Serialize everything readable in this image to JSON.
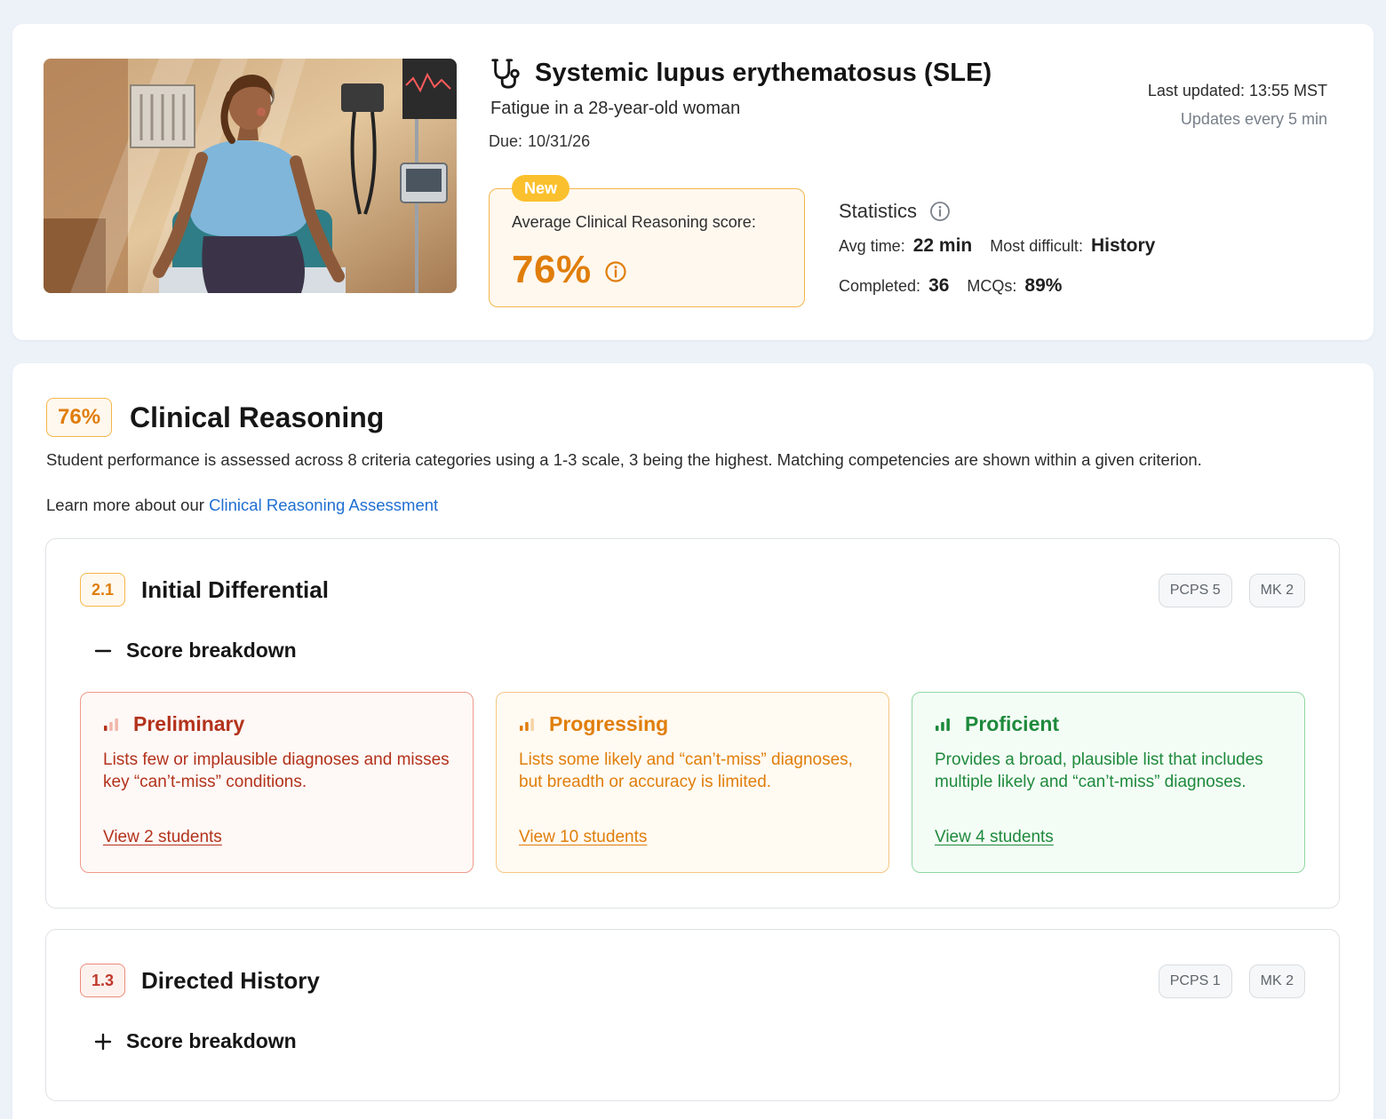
{
  "colors": {
    "page_bg": "#edf2f9",
    "accent_orange": "#e07e0b",
    "badge_yellow": "#fbc02d",
    "link_blue": "#1f6fd1",
    "preliminary_red": "#b3321b",
    "proficient_green": "#1e8a3c"
  },
  "case": {
    "title": "Systemic lupus erythematosus (SLE)",
    "title_icon": "stethoscope-icon",
    "subtitle": "Fatigue in a 28-year-old woman",
    "due_label": "Due:",
    "due_value": "10/31/26",
    "last_updated": "Last updated: 13:55 MST",
    "update_frequency": "Updates every 5 min",
    "image_alt": "Illustration of a tired young woman seated on an exam table in a clinic"
  },
  "score_box": {
    "badge": "New",
    "label": "Average Clinical Reasoning score:",
    "value": "76%"
  },
  "statistics": {
    "title": "Statistics",
    "avg_time_label": "Avg time:",
    "avg_time_value": "22 min",
    "most_difficult_label": "Most difficult:",
    "most_difficult_value": "History",
    "completed_label": "Completed:",
    "completed_value": "36",
    "mcqs_label": "MCQs:",
    "mcqs_value": "89%"
  },
  "clinical_reasoning": {
    "score": "76%",
    "title": "Clinical Reasoning",
    "description": "Student performance is assessed across 8 criteria categories using a 1-3 scale, 3 being the highest. Matching competencies are shown within a given criterion.",
    "learn_more_prefix": "Learn more about our",
    "learn_more_link": "Clinical Reasoning Assessment"
  },
  "criteria": [
    {
      "number": "2.1",
      "title": "Initial Differential",
      "tags": [
        "PCPS 5",
        "MK 2"
      ],
      "breakdown_label": "Score breakdown",
      "expanded": true,
      "levels": [
        {
          "title": "Preliminary",
          "description": "Lists few or implausible diagnoses and misses key “can’t-miss” conditions.",
          "link": "View 2 students"
        },
        {
          "title": "Progressing",
          "description": "Lists some likely and “can’t-miss” diagnoses, but breadth or accuracy is limited.",
          "link": "View 10 students"
        },
        {
          "title": "Proficient",
          "description": "Provides a broad, plausible list that includes multiple likely and “can’t-miss” diagnoses.",
          "link": "View 4 students"
        }
      ]
    },
    {
      "number": "1.3",
      "title": "Directed History",
      "tags": [
        "PCPS 1",
        "MK 2"
      ],
      "breakdown_label": "Score breakdown",
      "expanded": false
    }
  ]
}
